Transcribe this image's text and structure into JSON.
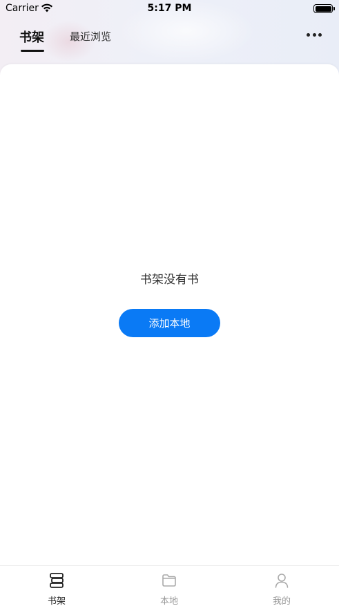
{
  "status_bar": {
    "carrier": "Carrier",
    "time": "5:17 PM"
  },
  "header": {
    "tabs": [
      {
        "label": "书架",
        "active": true
      },
      {
        "label": "最近浏览",
        "active": false
      }
    ],
    "more_icon": "more-horizontal-icon"
  },
  "main": {
    "empty_message": "书架没有书",
    "add_button_label": "添加本地",
    "accent_color": "#0a7af5"
  },
  "tab_bar": {
    "items": [
      {
        "label": "书架",
        "icon": "bookshelf-icon",
        "active": true
      },
      {
        "label": "本地",
        "icon": "folder-icon",
        "active": false
      },
      {
        "label": "我的",
        "icon": "user-icon",
        "active": false
      }
    ]
  }
}
